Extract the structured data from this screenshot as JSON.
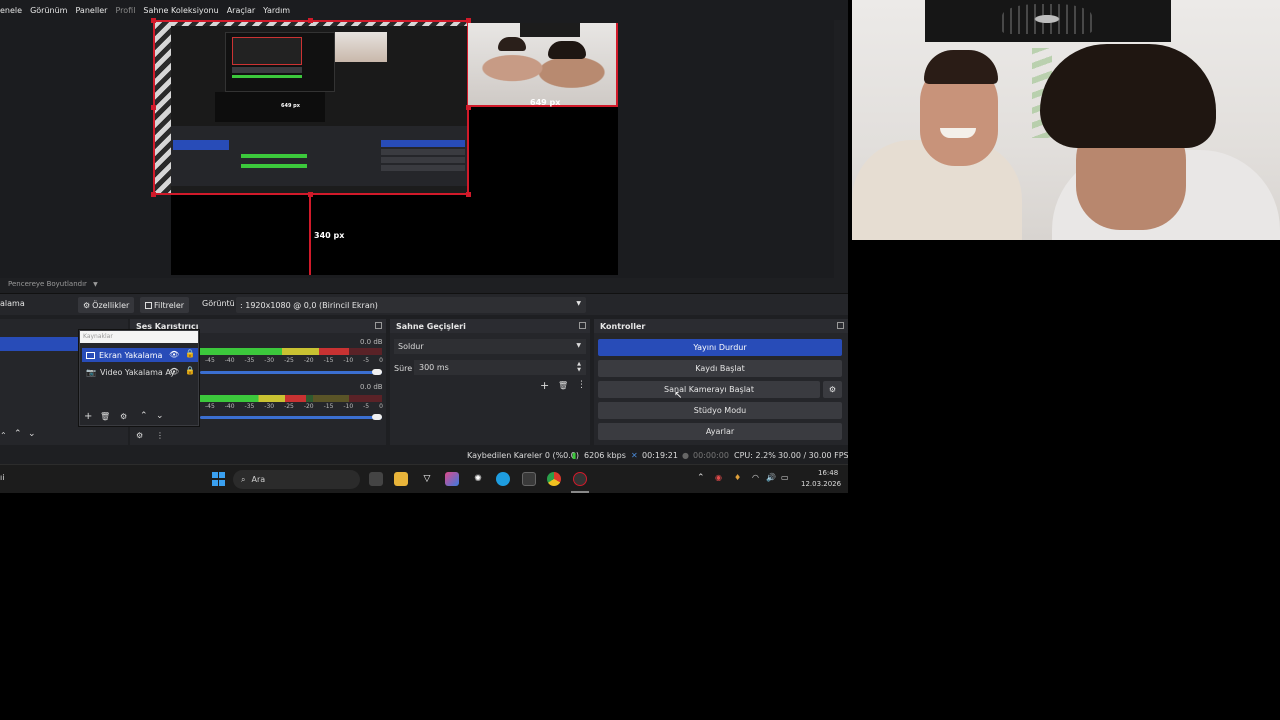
{
  "menu": {
    "items": [
      {
        "label": "enele",
        "dim": false
      },
      {
        "label": "Görünüm",
        "dim": false
      },
      {
        "label": "Paneller",
        "dim": false
      },
      {
        "label": "Profil",
        "dim": true
      },
      {
        "label": "Sahne Koleksiyonu",
        "dim": false
      },
      {
        "label": "Araçlar",
        "dim": false
      },
      {
        "label": "Yardım",
        "dim": false
      }
    ]
  },
  "preview": {
    "cam_width_label": "649 px",
    "inner_label": "649 px",
    "bottom_label": "340 px",
    "fit_label": "Pencereye Boyutlandır"
  },
  "context": {
    "source_name": "alama",
    "properties_label": "Özellikler",
    "filters_label": "Filtreler",
    "display_label": "Görüntü",
    "display_value": ": 1920x1080 @ 0,0 (Birincil Ekran)"
  },
  "sources": {
    "popup_title": "Kaynaklar",
    "mixer_title": "Ses Karıştırıcı",
    "items": [
      {
        "label": "Ekran Yakalama"
      },
      {
        "label": "Video Yakalama Ay"
      }
    ]
  },
  "mixer": {
    "track1_db": "0.0 dB",
    "track2_db": "0.0 dB",
    "scale": [
      "-45",
      "-40",
      "-35",
      "-30",
      "-25",
      "-20",
      "-15",
      "-10",
      "-5",
      "0"
    ],
    "track1_level": 0.82,
    "track2_level": 0.58
  },
  "transitions": {
    "title": "Sahne Geçişleri",
    "selected": "Soldur",
    "duration_label": "Süre",
    "duration_value": "300 ms"
  },
  "controls": {
    "title": "Kontroller",
    "stop_stream": "Yayını Durdur",
    "start_record": "Kaydı Başlat",
    "start_vcam": "Sanal Kamerayı Başlat",
    "studio_mode": "Stüdyo Modu",
    "settings": "Ayarlar"
  },
  "status": {
    "dropped": "Kaybedilen Kareler 0 (%0.0)",
    "bitrate": "6206 kbps",
    "stream_time": "00:19:21",
    "record_time": "00:00:00",
    "cpu": "CPU: 2.2%",
    "fps": "30.00 / 30.00 FPS"
  },
  "taskbar": {
    "search_placeholder": "Ara",
    "time": "16:48",
    "date": "12.03.2026",
    "left_fragment": "ıi"
  },
  "colors": {
    "accent": "#284cb8",
    "selection_red": "#d11a2a",
    "meter_green": "#3cc83c"
  }
}
